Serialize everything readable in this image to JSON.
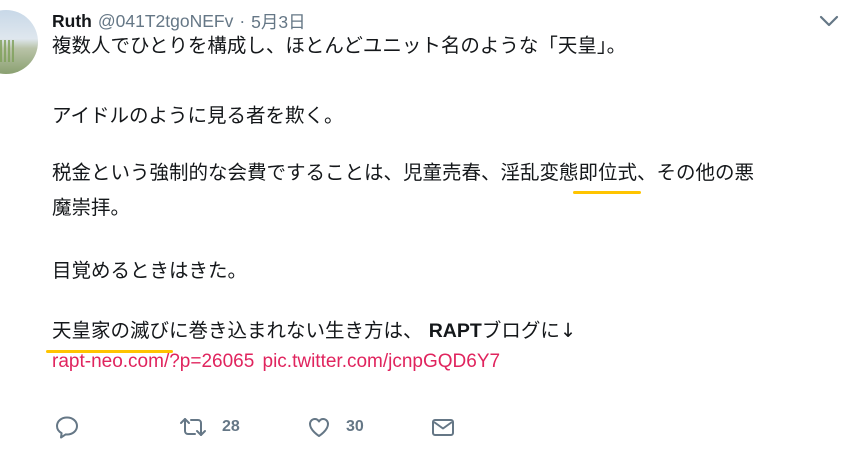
{
  "tweet": {
    "author_name": "Ruth",
    "handle": "@041T2tgoNEFv",
    "separator": "·",
    "date": "5月3日",
    "lines": {
      "l1": "複数人でひとりを構成し、ほとんどユニット名のような「天皇」。",
      "l2": "アイドルのように見る者を欺く。",
      "l3a": "税金という強制的な会費ですることは、児童売春、淫乱変態",
      "l3b": "即位式",
      "l3c": "、その他の悪",
      "l4": "魔崇拝。",
      "l5": "目覚めるときはきた。",
      "l6a": "天皇家の滅び",
      "l6b": "に巻き込まれない生き方は、 ",
      "l6c": "RAPT",
      "l6d": "ブログに↓"
    },
    "link_url_text": "rapt-neo.com/?p=26065",
    "link_pic_text": "pic.twitter.com/jcnpGQD6Y7"
  },
  "actions": {
    "reply_icon": "speech-bubble-icon",
    "retweet_icon": "retweet-arrows-icon",
    "retweet_count": "28",
    "like_icon": "heart-icon",
    "like_count": "30",
    "dm_icon": "envelope-icon"
  },
  "colors": {
    "text": "#14171a",
    "meta": "#657786",
    "link": "#e0245e",
    "highlight_underline": "#ffc400"
  }
}
